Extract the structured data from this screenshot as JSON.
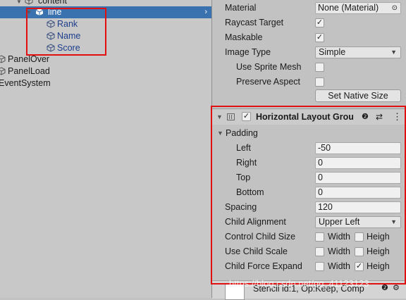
{
  "hierarchy": {
    "items": [
      {
        "label": "content",
        "level": "parent"
      },
      {
        "label": "line",
        "selected": true
      },
      {
        "label": "Rank"
      },
      {
        "label": "Name"
      },
      {
        "label": "Score"
      },
      {
        "label": "PanelOver"
      },
      {
        "label": "PanelLoad"
      },
      {
        "label": "EventSystem"
      }
    ]
  },
  "image": {
    "material_label": "Material",
    "material_value": "None (Material)",
    "raycast_label": "Raycast Target",
    "maskable_label": "Maskable",
    "image_type_label": "Image Type",
    "image_type_value": "Simple",
    "use_sprite_mesh_label": "Use Sprite Mesh",
    "preserve_aspect_label": "Preserve Aspect",
    "set_native_size_label": "Set Native Size"
  },
  "layout_group": {
    "title": "Horizontal Layout Grou",
    "padding_label": "Padding",
    "left_label": "Left",
    "left_value": "-50",
    "right_label": "Right",
    "right_value": "0",
    "top_label": "Top",
    "top_value": "0",
    "bottom_label": "Bottom",
    "bottom_value": "0",
    "spacing_label": "Spacing",
    "spacing_value": "120",
    "child_alignment_label": "Child Alignment",
    "child_alignment_value": "Upper Left",
    "control_child_size_label": "Control Child Size",
    "use_child_scale_label": "Use Child Scale",
    "child_force_expand_label": "Child Force Expand",
    "width_label": "Width",
    "height_label": "Heigh"
  },
  "bottom": {
    "stencil_text": "Stencil id:1, Op:Keep, Comp"
  },
  "watermark": "https://blog.csdn.net/qq_41123123",
  "colors": {
    "selection": "#3a72b0",
    "highlight_box": "#e01010"
  }
}
